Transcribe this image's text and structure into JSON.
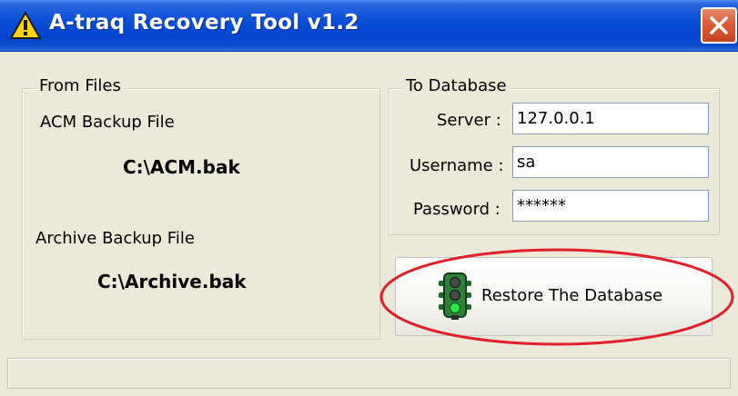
{
  "window": {
    "title": "A-traq Recovery Tool v1.2",
    "title_icon": "warning-icon",
    "close_icon": "close-icon"
  },
  "from_files": {
    "legend": "From Files",
    "acm_label": "ACM Backup File",
    "acm_value": "C:\\ACM.bak",
    "archive_label": "Archive Backup File",
    "archive_value": "C:\\Archive.bak"
  },
  "to_database": {
    "legend": "To Database",
    "server_label": "Server :",
    "server_value": "127.0.0.1",
    "username_label": "Username :",
    "username_value": "sa",
    "password_label": "Password :",
    "password_value": "******"
  },
  "restore_button": {
    "label": "Restore The Database",
    "icon": "traffic-light-icon"
  },
  "colors": {
    "titlebar": "#0a4fd6",
    "window_bg": "#ece9d8",
    "highlight_ellipse": "#e0202a"
  }
}
